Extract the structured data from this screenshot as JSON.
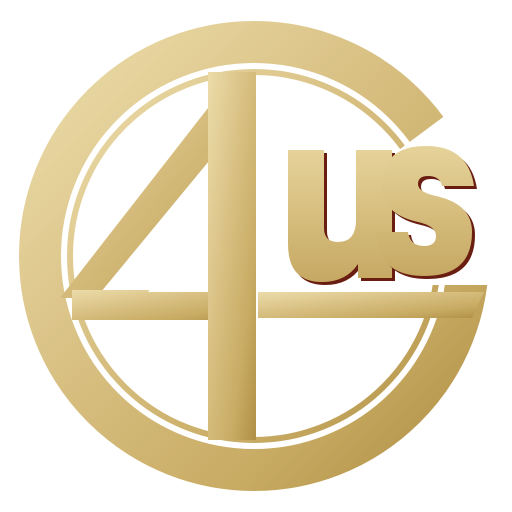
{
  "logo": {
    "text": "4US",
    "number": "4",
    "letters": "us"
  },
  "colors": {
    "background": "#ffffff",
    "gold_light": "#e8d7a0",
    "gold_mid": "#cdb26c",
    "gold_dark": "#a8873e",
    "shadow": "#6a1e12"
  }
}
